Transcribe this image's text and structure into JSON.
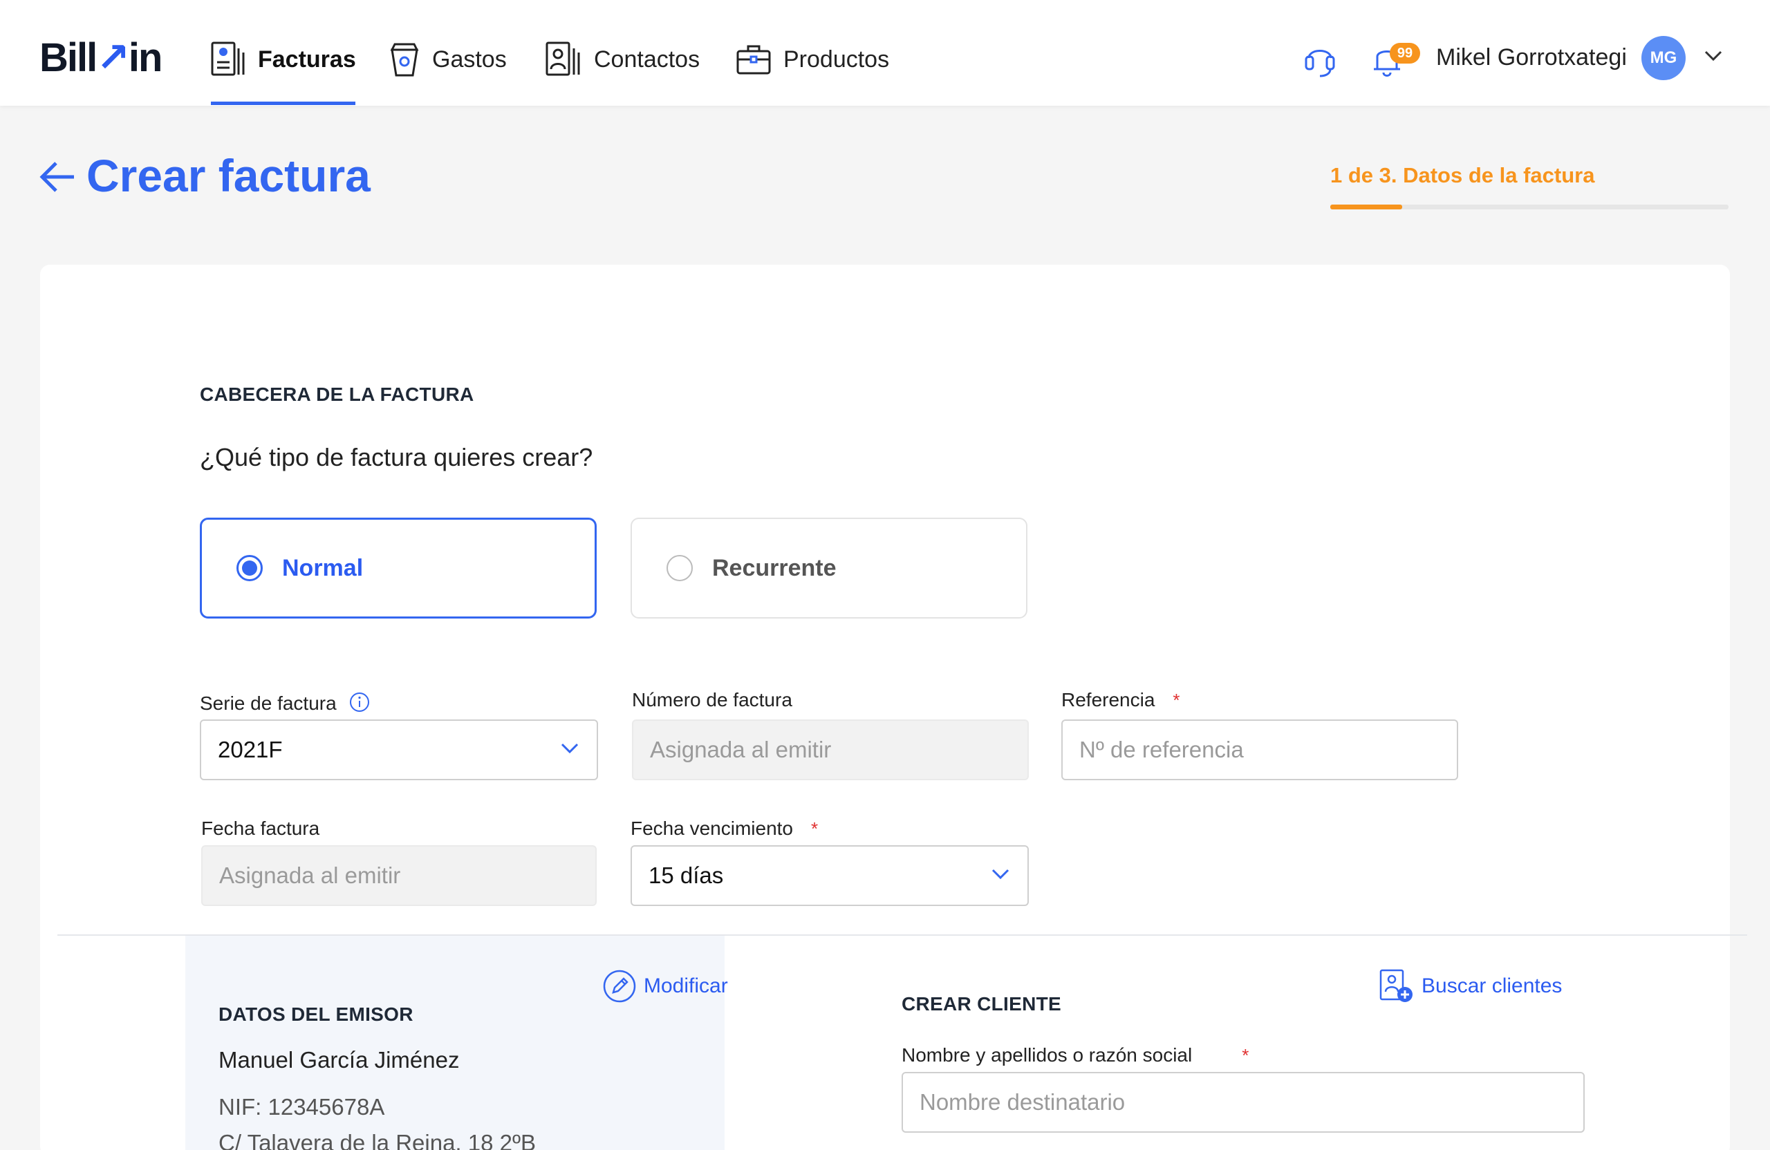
{
  "app": {
    "logo_main": "Bill",
    "logo_accent": "in"
  },
  "nav": {
    "items": [
      {
        "label": "Facturas",
        "icon": "invoice-icon",
        "active": true
      },
      {
        "label": "Gastos",
        "icon": "cup-icon",
        "active": false
      },
      {
        "label": "Contactos",
        "icon": "contacts-icon",
        "active": false
      },
      {
        "label": "Productos",
        "icon": "briefcase-icon",
        "active": false
      }
    ]
  },
  "user": {
    "notifications": "99",
    "name": "Mikel Gorrotxategi",
    "initials": "MG"
  },
  "page": {
    "title": "Crear factura",
    "step_label": "1 de 3. Datos de la factura",
    "step_progress": 0.18
  },
  "header_section": {
    "title": "CABECERA DE LA FACTURA",
    "question": "¿Qué tipo de factura quieres crear?",
    "options": [
      {
        "label": "Normal",
        "selected": true
      },
      {
        "label": "Recurrente",
        "selected": false
      }
    ]
  },
  "form": {
    "serie": {
      "label": "Serie de factura",
      "value": "2021F"
    },
    "numero": {
      "label": "Número de factura",
      "placeholder": "Asignada al emitir"
    },
    "referencia": {
      "label": "Referencia",
      "required_mark": "*",
      "placeholder": "Nº de referencia"
    },
    "fecha": {
      "label": "Fecha factura",
      "placeholder": "Asignada al emitir"
    },
    "vencimiento": {
      "label": "Fecha vencimiento",
      "required_mark": "*",
      "value": "15 días"
    }
  },
  "emisor": {
    "title": "DATOS DEL EMISOR",
    "edit_label": "Modificar",
    "name": "Manuel García Jiménez",
    "nif": "NIF: 12345678A",
    "address": "C/ Talavera de la Reina, 18 2ºB"
  },
  "cliente": {
    "title": "CREAR CLIENTE",
    "search_label": "Buscar clientes",
    "name_label": "Nombre y apellidos o razón social",
    "required_mark": "*",
    "name_placeholder": "Nombre destinatario"
  },
  "colors": {
    "primary": "#3366f0",
    "accent": "#f7941d",
    "required": "#e03131"
  }
}
